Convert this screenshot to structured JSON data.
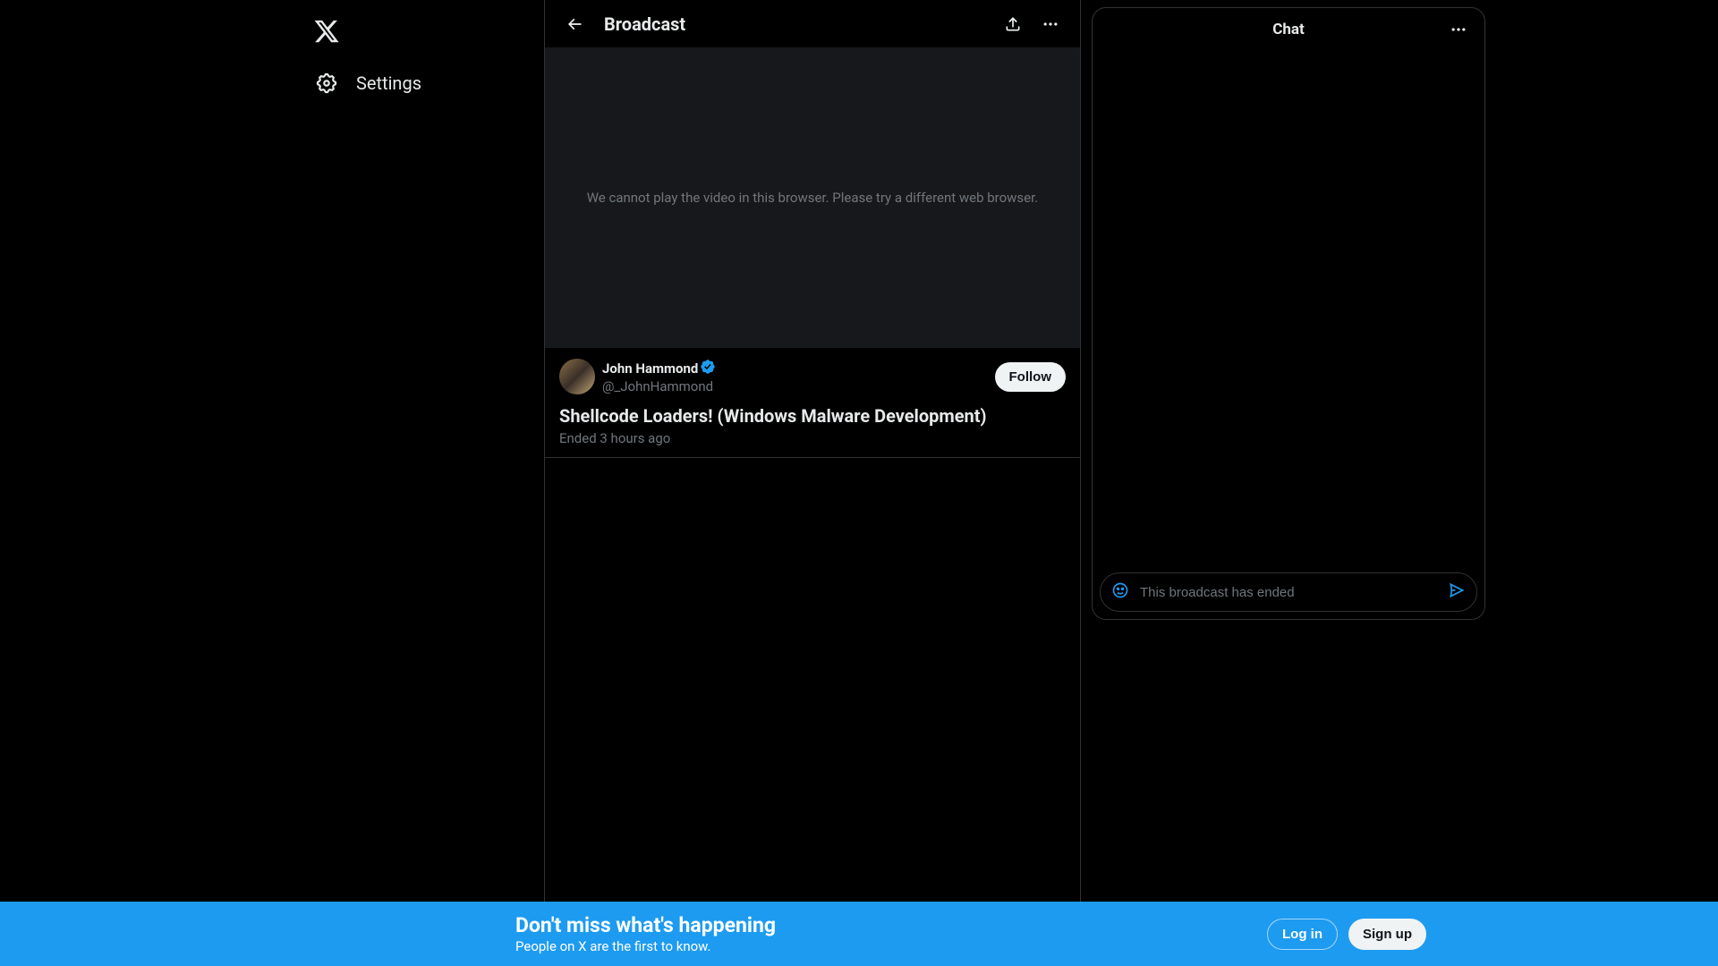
{
  "sidebar": {
    "settings_label": "Settings"
  },
  "header": {
    "title": "Broadcast"
  },
  "video": {
    "error_message": "We cannot play the video in this browser. Please try a different web browser."
  },
  "broadcast": {
    "user_name": "John Hammond",
    "user_handle": "@_JohnHammond",
    "follow_label": "Follow",
    "title": "Shellcode Loaders! (Windows Malware Development)",
    "time_status": "Ended 3 hours ago"
  },
  "chat": {
    "title": "Chat",
    "input_placeholder": "This broadcast has ended"
  },
  "banner": {
    "title": "Don't miss what's happening",
    "subtitle": "People on X are the first to know.",
    "login_label": "Log in",
    "signup_label": "Sign up"
  }
}
